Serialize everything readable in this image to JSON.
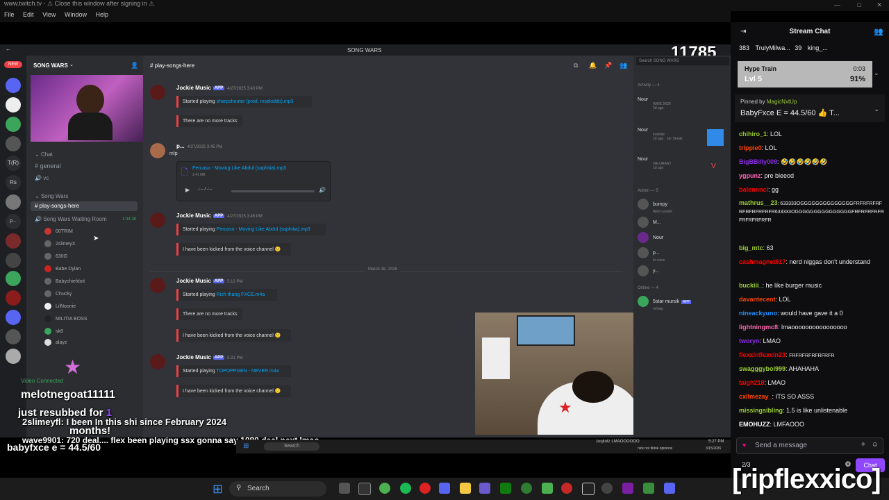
{
  "window": {
    "title": "www.twitch.tv - ⚠ Close this window after signing in ⚠",
    "menu": [
      "File",
      "Edit",
      "View",
      "Window",
      "Help"
    ]
  },
  "viewer_count": "11785",
  "discord": {
    "title": "SONG WARS",
    "server_name": "SONG WARS",
    "channel_title": "play-songs-here",
    "search_placeholder": "Search SONG WARS",
    "categories": {
      "chat": "Chat",
      "song_wars": "Song Wars"
    },
    "channels": {
      "general": "general",
      "vc": "vc",
      "play": "play-songs-here",
      "waiting": "Song Wars Waiting Room",
      "waiting_time": "1:44:38"
    },
    "voice_users": [
      "00TRIM",
      "2slimeyX",
      "630G",
      "Babe Dylan",
      "Babychiefdoit",
      "Chucky",
      "LilNoonie",
      "MILITIA BOSS",
      "sk8",
      "alayz"
    ],
    "date_divider": "March 16, 2026",
    "messages": [
      {
        "name": "Jockie Music",
        "tag": "APP",
        "time": "4/27/2025 3:43 PM",
        "line1": "Started playing ",
        "link": "sharpshooter (prod. rxsekiddo).mp3",
        "line2": "There are no more tracks"
      },
      {
        "name": "p...",
        "time": "4/27/2025 3:45 PM",
        "text": "m!p",
        "file": "Percaso - Moving Like Abdul (sophitia).mp3",
        "filesize": "2.41 MB",
        "player_time": "-:-- / -:--"
      },
      {
        "name": "Jockie Music",
        "tag": "APP",
        "time": "4/27/2025 3:45 PM",
        "line1": "Started playing ",
        "link": "Percaso - Moving Like Abdul (sophitia).mp3",
        "line2": "I have been kicked from the voice channel 🙁"
      },
      {
        "name": "Jockie Music",
        "tag": "APP",
        "time": "5:13 PM",
        "line1": "Started playing ",
        "link": "Rich thang FXCE.m4a",
        "line2": "There are no more tracks",
        "line3": "I have been kicked from the voice channel 🙁"
      },
      {
        "name": "Jockie Music",
        "tag": "APP",
        "time": "5:21 PM",
        "line1": "Started playing ",
        "link": "TOPOPPGEN - NEVER.m4a",
        "line2": "I have been kicked from the voice channel 🙁"
      }
    ],
    "activity_label": "Activity — 4",
    "activities": [
      {
        "name": "Nour",
        "game": "WWE 2K26",
        "meta": "2d ago"
      },
      {
        "name": "Nour",
        "game": "Fortnite",
        "meta": "2d ago · 1hr Streak"
      },
      {
        "name": "Nour",
        "game": "VALORANT",
        "meta": "1d ago"
      }
    ],
    "admin_label": "Admin — 5",
    "admins": [
      {
        "name": "bumpy",
        "sub": "tMod Leader"
      },
      {
        "name": "M..."
      },
      {
        "name": "Nour"
      },
      {
        "name": "p...",
        "sub": "In voice"
      },
      {
        "name": "y..."
      }
    ],
    "online_label": "Online — 4",
    "online": [
      {
        "name": "5star mursik",
        "tag": "APP",
        "sub": "m!help"
      }
    ]
  },
  "stream_chat": {
    "title": "Stream Chat",
    "leaderboard": [
      {
        "value": "383"
      },
      {
        "name": "TrulyMilwa...",
        "value": "39"
      },
      {
        "name": "king_..."
      }
    ],
    "hype_train": {
      "title": "Hype Train",
      "level": "Lvl 5",
      "timer": "0:03",
      "percent": "91%"
    },
    "pinned_by": "Pinned by",
    "pinned_user": "MagicNxtUp",
    "pinned_text": "BabyFxce E = 44.5/60 👍 T...",
    "messages": [
      {
        "user": "chihiro_1",
        "color": "#9acd32",
        "text": "LOL"
      },
      {
        "user": "trippie0",
        "color": "#ff4500",
        "text": "LOL"
      },
      {
        "user": "BigBBilly009",
        "color": "#8a2be2",
        "text": "🤣🤣🤣🤣🤣🤣"
      },
      {
        "user": "ygpunz",
        "color": "#ff69b4",
        "text": "pre bleeod"
      },
      {
        "user": "balennnci",
        "color": "#ff0000",
        "text": "gg"
      },
      {
        "user": "mathrus__23",
        "color": "#9acd32",
        "text": "633333OGGGGGGGGGGGGGGFRFRFRFRFRFRFRFRFRFR633333OGGGGGGGGGGGGGGGFRFRFRFRFRFRFRFRFRFR"
      },
      {
        "user": "big_mtc",
        "color": "#9acd32",
        "text": "63"
      },
      {
        "user": "cashmagnet617",
        "color": "#ff0000",
        "text": "nerd niggas don't understand"
      },
      {
        "user": "buckiii_",
        "color": "#9acd32",
        "text": "he like burger music"
      },
      {
        "user": "davantecent",
        "color": "#ff4500",
        "text": "LOL"
      },
      {
        "user": "nineackyuno",
        "color": "#1e90ff",
        "text": "would have gave it a 0"
      },
      {
        "user": "lightningmc8",
        "color": "#ff69b4",
        "text": "lmaoooooooooooooooo"
      },
      {
        "user": "tworyn",
        "color": "#8a2be2",
        "text": "LMAO"
      },
      {
        "user": "flexxinflexxin23",
        "color": "#ff0000",
        "text": "FRFRFRFRFRFRFR"
      },
      {
        "user": "swagggyboi999",
        "color": "#9acd32",
        "text": "AHAHAHA"
      },
      {
        "user": "taigh218",
        "color": "#ff0000",
        "text": "LMAO"
      },
      {
        "user": "cxllmezay_",
        "color": "#ff4500",
        "text": "ITS SO ASSS"
      },
      {
        "user": "missingsibling",
        "color": "#9acd32",
        "text": "1.5 is like unlistenable"
      },
      {
        "user": "EMOHUZZ",
        "color": "#ffffff",
        "text": "LMFAOOO"
      }
    ],
    "input_placeholder": "Send a message",
    "counter": "2/3",
    "chat_button": "Chat"
  },
  "overlays": {
    "resub_user": "melotnegoat11111",
    "resub_text": "just resubbed for",
    "resub_months": "1",
    "resub_months_label": "months!",
    "video_connected": "Video Connected",
    "line1_user": "2slimeyfl",
    "line1_text": ": I been In this shi since February 2024",
    "line2_user": "wave9901",
    "line2_text": ": 720 deal.... flex been playing ssx gonna say 1080 deal next lmao",
    "line3": "babyfxce e = 44.5/60",
    "watermark": "[ripflexxico]",
    "mini_chat_user": "zuqkotz",
    "mini_chat_text": "LMAOOOOOO",
    "mini_chat_line2": "nick not tiktok opinions",
    "mini_time": "5:27 PM",
    "mini_date": "3/15/2026",
    "mini_search": "Search",
    "taskbar_search": "Search"
  },
  "colors": {
    "discord_bg": "#313338",
    "twitch_purple": "#9147ff",
    "discord_blurple": "#5865f2",
    "embed_red": "#ed4245"
  }
}
